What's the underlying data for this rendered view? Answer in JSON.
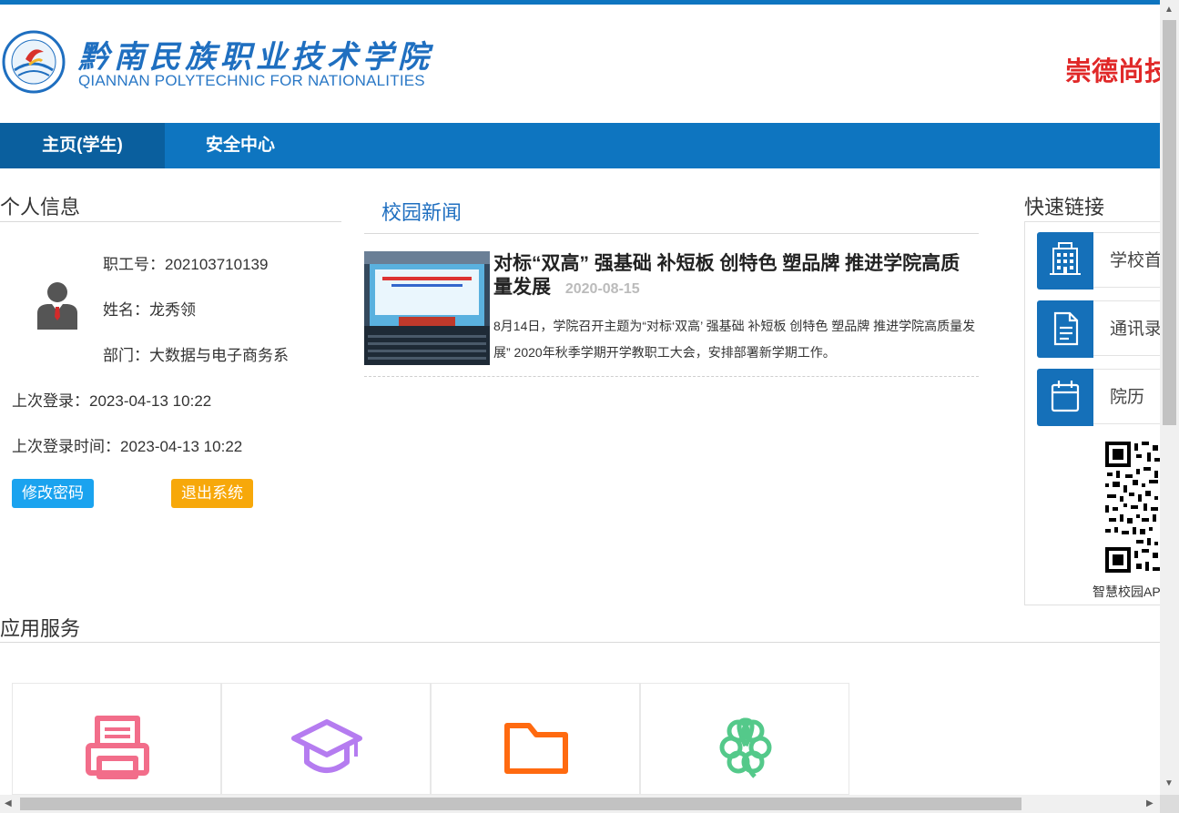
{
  "header": {
    "school_name_cn": "黔南民族职业技术学院",
    "school_name_en": "QIANNAN POLYTECHNIC FOR NATIONALITIES",
    "slogan": "崇德尚技"
  },
  "nav": {
    "items": [
      {
        "label": "主页(学生)",
        "active": true
      },
      {
        "label": "安全中心",
        "active": false
      }
    ]
  },
  "personal": {
    "title": "个人信息",
    "staff_id": "职工号：202103710139",
    "name": "姓名：龙秀领",
    "department": "部门：大数据与电子商务系",
    "last_login": "上次登录：2023-04-13 10:22",
    "last_login_time": "上次登录时间：2023-04-13 10:22",
    "change_password": "修改密码",
    "logout": "退出系统"
  },
  "news": {
    "title": "校园新闻",
    "items": [
      {
        "headline": "对标“双高” 强基础 补短板 创特色 塑品牌 推进学院高质量发展",
        "date": "2020-08-15",
        "summary": "8月14日，学院召开主题为“对标‘双高’ 强基础 补短板 创特色 塑品牌 推进学院高质量发展” 2020年秋季学期开学教职工大会，安排部署新学期工作。"
      }
    ]
  },
  "quick_links": {
    "title": "快速链接",
    "items": [
      {
        "label": "学校首页",
        "icon": "building-icon"
      },
      {
        "label": "通讯录",
        "icon": "document-icon"
      },
      {
        "label": "院历",
        "icon": "calendar-icon"
      }
    ],
    "qr_label": "智慧校园APP"
  },
  "apps": {
    "title": "应用服务",
    "items": [
      {
        "icon": "printer-icon",
        "color": "#f26d8a"
      },
      {
        "icon": "graduation-cap-icon",
        "color": "#b57cf0"
      },
      {
        "icon": "folder-icon",
        "color": "#ff6a10"
      },
      {
        "icon": "clover-icon",
        "color": "#54c98a"
      }
    ]
  },
  "colors": {
    "primary": "#0e75c0",
    "nav_active": "#0a5f9e",
    "slogan": "#e02828",
    "btn_blue": "#1aa3ef",
    "btn_orange": "#f7a80a"
  }
}
